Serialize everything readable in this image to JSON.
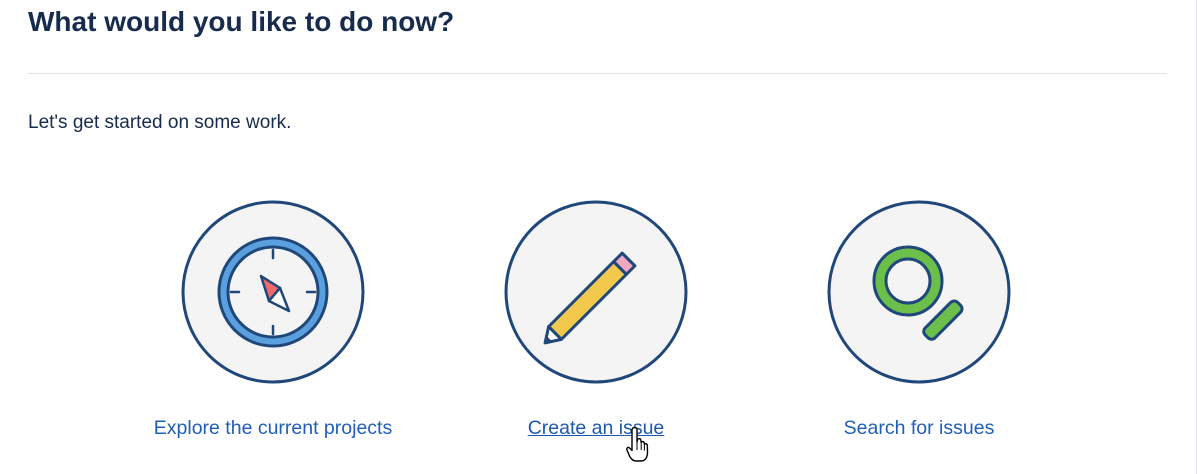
{
  "page": {
    "title": "What would you like to do now?",
    "intro": "Let's get started on some work."
  },
  "actions": [
    {
      "label": "Explore the current projects",
      "icon": "compass-icon",
      "hovered": false
    },
    {
      "label": "Create an issue",
      "icon": "pencil-icon",
      "hovered": true
    },
    {
      "label": "Search for issues",
      "icon": "magnifier-icon",
      "hovered": false
    }
  ],
  "colors": {
    "text": "#172b4d",
    "link": "#205fb7",
    "circle_fill": "#f4f4f4",
    "circle_stroke": "#20477a",
    "compass_ring": "#5aa0de",
    "compass_needle": "#ef6a6a",
    "pencil_body": "#f2c94c",
    "pencil_eraser": "#f2a7c3",
    "magnifier": "#6cbf4b",
    "divider": "#dfe1e6"
  }
}
